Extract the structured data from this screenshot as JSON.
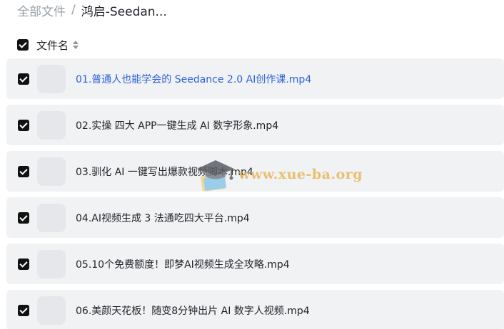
{
  "breadcrumb": {
    "root": "全部文件",
    "separator": "/",
    "current": "鸿启-Seedan..."
  },
  "list_header": {
    "column_label": "文件名",
    "select_all_checked": true
  },
  "files": [
    {
      "name": "01.普通人也能学会的 Seedance 2.0 AI创作课.mp4",
      "checked": true,
      "active": true
    },
    {
      "name": "02.实操 四大 APP一键生成 AI 数字形象.mp4",
      "checked": true,
      "active": false
    },
    {
      "name": "03.驯化 AI 一键写出爆款视频脚本.mp4",
      "checked": true,
      "active": false
    },
    {
      "name": "04.AI视频生成 3 法通吃四大平台.mp4",
      "checked": true,
      "active": false
    },
    {
      "name": "05.10个免费额度！即梦AI视频生成全攻略.mp4",
      "checked": true,
      "active": false
    },
    {
      "name": "06.美颜天花板！随变8分钟出片 AI 数字人视频.mp4",
      "checked": true,
      "active": false
    }
  ],
  "watermark": {
    "text": "www.xue-ba.org",
    "icon": "graduation-cap-icon"
  },
  "colors": {
    "active_link": "#2b62d9",
    "row_background": "#f1f2f4",
    "checkbox": "#111111",
    "watermark": "#e8b75a"
  }
}
